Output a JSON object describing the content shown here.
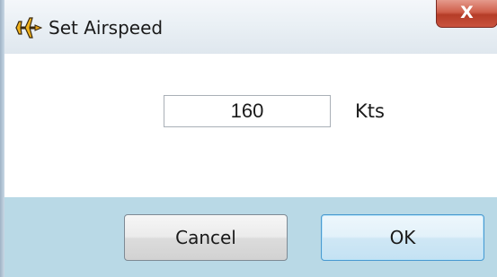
{
  "window": {
    "title": "Set Airspeed",
    "title_icon": "airplane-icon",
    "close_glyph": "X"
  },
  "form": {
    "airspeed_value": "160",
    "unit_label": "Kts"
  },
  "buttons": {
    "cancel_label": "Cancel",
    "ok_label": "OK"
  },
  "colors": {
    "close_button": "#c9533f",
    "footer_background": "#b9d9e6",
    "ok_button_border": "#4a9ad0"
  }
}
